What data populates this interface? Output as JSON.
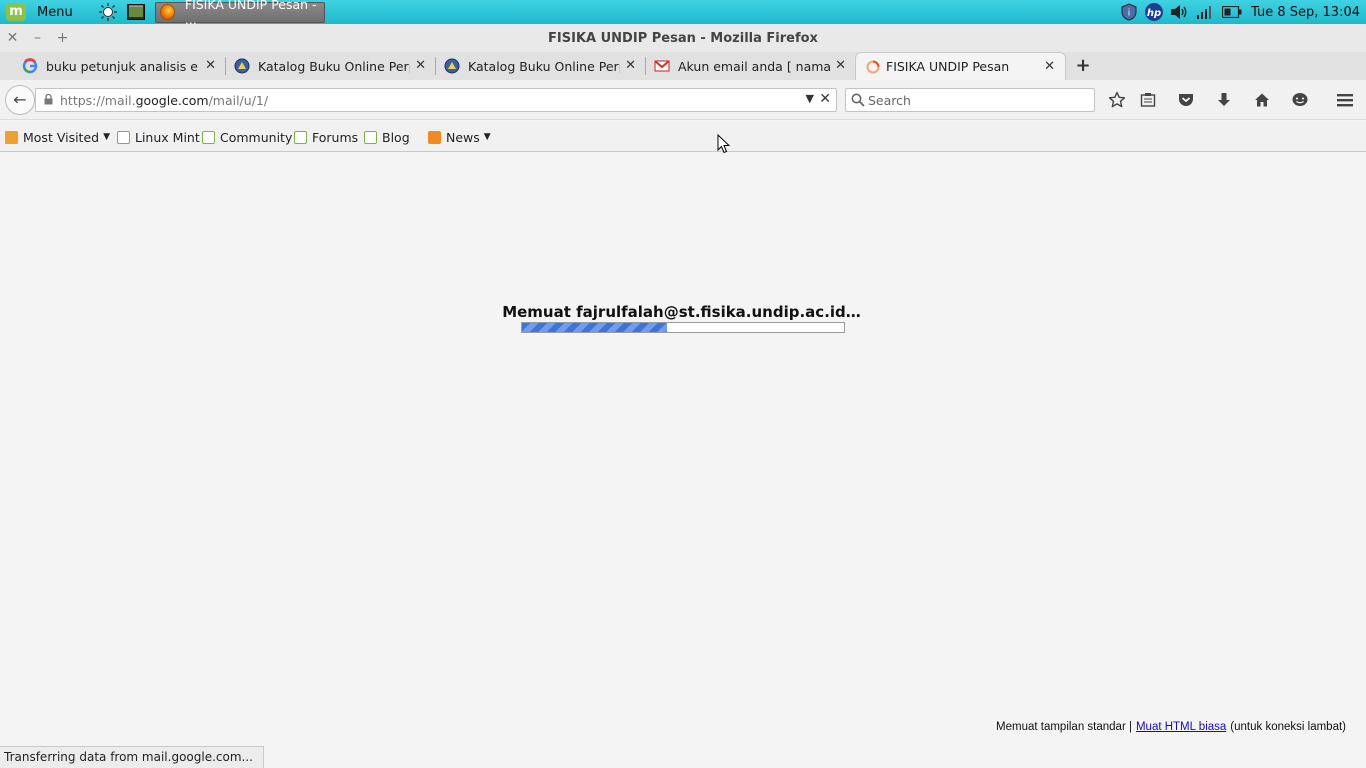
{
  "panel": {
    "menu_label": "Menu",
    "mint_glyph": "m",
    "taskbar_title": "FISIKA UNDIP Pesan - ...",
    "clock": "Tue  8 Sep, 13:04",
    "icons": [
      "sun-icon",
      "terminal-icon",
      "firefox-icon",
      "shield-icon",
      "hp-icon",
      "volume-icon",
      "signal-icon",
      "battery-icon"
    ]
  },
  "window": {
    "title": "FISIKA UNDIP Pesan - Mozilla Firefox",
    "close_glyph": "✕",
    "minimize_glyph": "–",
    "maximize_glyph": "+"
  },
  "tabs": [
    {
      "label": "buku petunjuk analisis ek...",
      "icon": "google-icon"
    },
    {
      "label": "Katalog Buku Online Perp...",
      "icon": "library-icon"
    },
    {
      "label": "Katalog Buku Online Perp...",
      "icon": "library-icon"
    },
    {
      "label": "Akun email anda [ nama...",
      "icon": "gmail-icon"
    },
    {
      "label": "FISIKA UNDIP Pesan",
      "icon": "loading-icon",
      "active": true
    }
  ],
  "tab_close_glyph": "✕",
  "new_tab_glyph": "+",
  "navbar": {
    "back_glyph": "←",
    "url_prefix": "https://mail.",
    "url_domain": "google.com",
    "url_suffix": "/mail/u/1/",
    "search_placeholder": "Search",
    "dropdown_glyph": "▼",
    "clear_glyph": "✕"
  },
  "bookmarks": [
    {
      "label": "Most Visited",
      "icon": "folder-icon",
      "dropdown": true
    },
    {
      "label": "Linux Mint",
      "icon": "mint-icon"
    },
    {
      "label": "Community",
      "icon": "mint-icon"
    },
    {
      "label": "Forums",
      "icon": "mint-icon"
    },
    {
      "label": "Blog",
      "icon": "mint-icon"
    },
    {
      "label": "News",
      "icon": "rss-icon",
      "dropdown": true
    }
  ],
  "bookmark_caret": "▼",
  "content": {
    "loading_text": "Memuat fajrulfalah@st.fisika.undip.ac.id…",
    "progress_percent": 45,
    "footer_prefix": "Memuat tampilan standar |",
    "footer_link": "Muat HTML biasa",
    "footer_suffix": "(untuk koneksi lambat)"
  },
  "status": "Transferring data from mail.google.com...",
  "colors": {
    "panel": "#1fb8cc",
    "accent_blue": "#3d74d9",
    "link": "#1a0dab",
    "mint_green": "#8bc34a"
  }
}
